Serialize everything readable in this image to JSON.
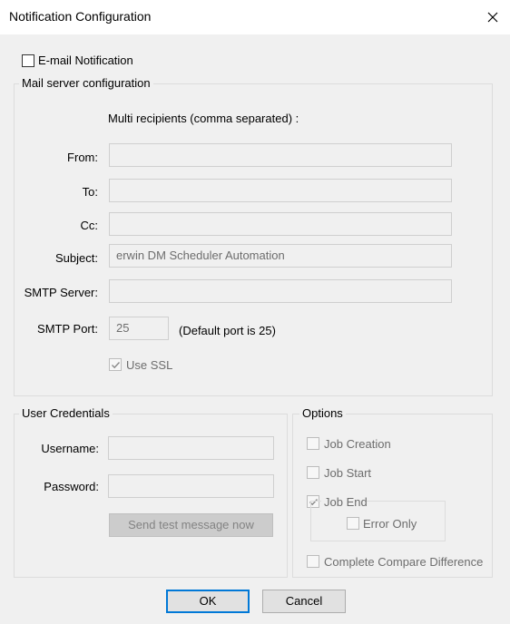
{
  "window": {
    "title": "Notification Configuration",
    "close_icon": "close-icon"
  },
  "email_notification": {
    "label": "E-mail Notification",
    "checked": false
  },
  "mail_server": {
    "legend": "Mail server configuration",
    "multi_recipients_note": "Multi recipients (comma separated) :",
    "from_label": "From:",
    "from_value": "",
    "to_label": "To:",
    "to_value": "",
    "cc_label": "Cc:",
    "cc_value": "",
    "subject_label": "Subject:",
    "subject_value": "erwin DM Scheduler Automation",
    "smtp_server_label": "SMTP Server:",
    "smtp_server_value": "",
    "smtp_port_label": "SMTP Port:",
    "smtp_port_value": "25",
    "default_port_note": "(Default port is 25)",
    "use_ssl_label": "Use SSL",
    "use_ssl_checked": true
  },
  "credentials": {
    "legend": "User Credentials",
    "username_label": "Username:",
    "username_value": "",
    "password_label": "Password:",
    "password_value": "",
    "test_button": "Send test message now"
  },
  "options": {
    "legend": "Options",
    "job_creation": {
      "label": "Job Creation",
      "checked": false
    },
    "job_start": {
      "label": "Job Start",
      "checked": false
    },
    "job_end": {
      "label": "Job End",
      "checked": true
    },
    "error_only": {
      "label": "Error Only",
      "checked": false
    },
    "complete_compare": {
      "label": "Complete Compare Difference",
      "checked": false
    }
  },
  "footer": {
    "ok": "OK",
    "cancel": "Cancel"
  },
  "colors": {
    "focus_border": "#0078d7",
    "window_bg": "#f0f0f0",
    "disabled_text": "#6d6d6d"
  }
}
